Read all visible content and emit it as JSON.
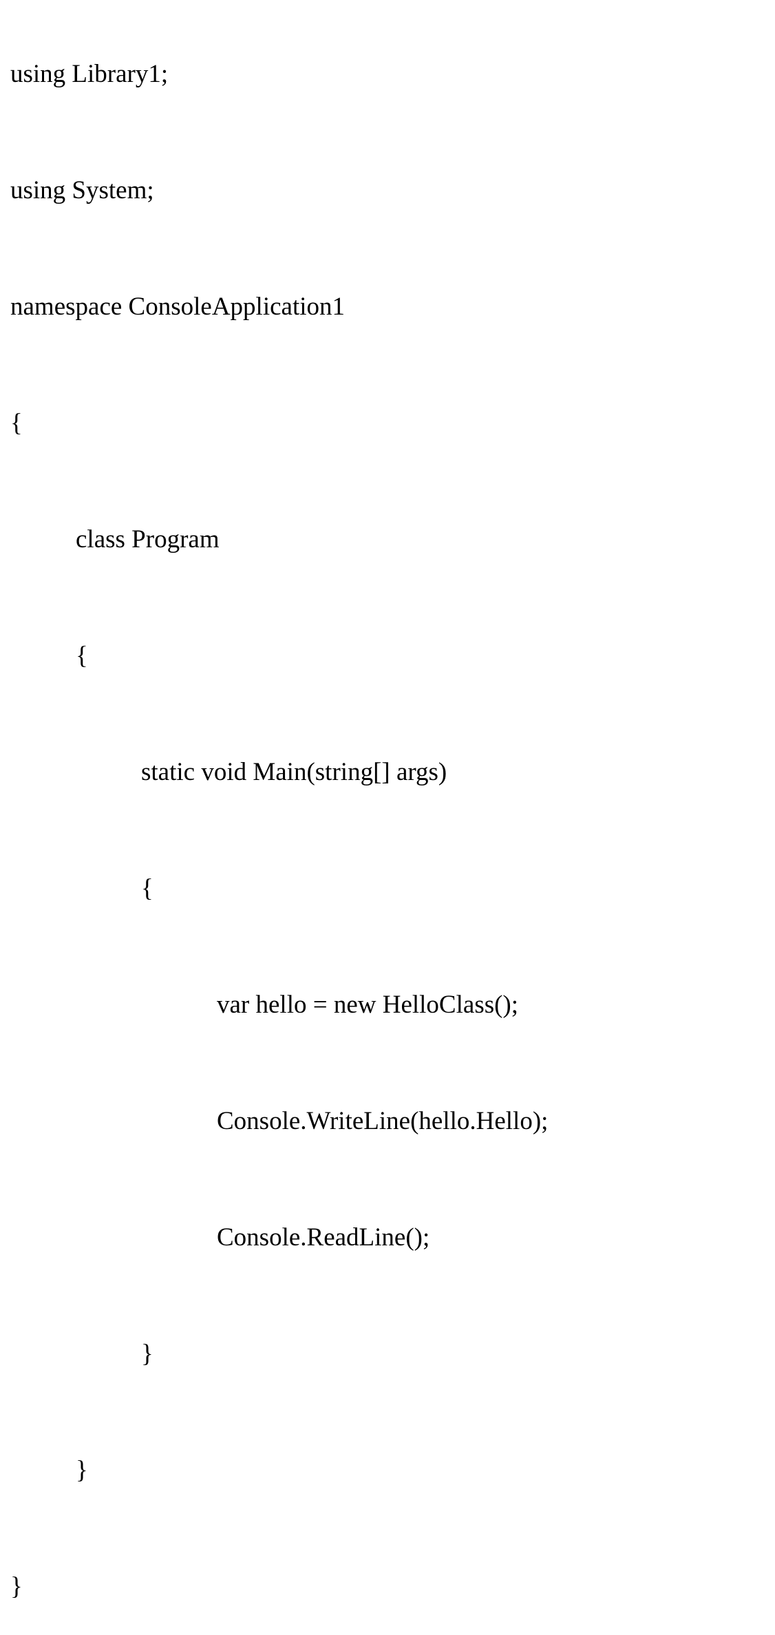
{
  "code": {
    "lines": [
      {
        "text": "using Library1;",
        "indent": 0
      },
      {
        "text": "using System;",
        "indent": 0
      },
      {
        "text": "namespace ConsoleApplication1",
        "indent": 0
      },
      {
        "text": "{",
        "indent": 0
      },
      {
        "text": "class Program",
        "indent": 1
      },
      {
        "text": "{",
        "indent": 1
      },
      {
        "text": "static void Main(string[] args)",
        "indent": 2
      },
      {
        "text": "{",
        "indent": 2
      },
      {
        "text": "var hello = new HelloClass();",
        "indent": 3
      },
      {
        "text": "Console.WriteLine(hello.Hello);",
        "indent": 3
      },
      {
        "text": "Console.ReadLine();",
        "indent": 3
      },
      {
        "text": "}",
        "indent": 2
      },
      {
        "text": "}",
        "indent": 1
      },
      {
        "text": "}",
        "indent": 0
      }
    ]
  }
}
